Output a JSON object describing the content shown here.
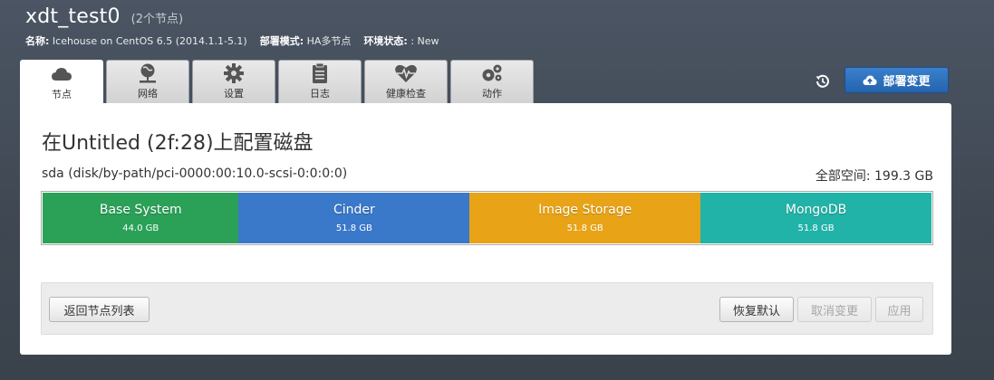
{
  "header": {
    "cluster_name": "xdt_test0",
    "node_count": "(2个节点)",
    "meta_name_label": "名称:",
    "meta_name_value": "Icehouse on CentOS 6.5 (2014.1.1-5.1)",
    "meta_mode_label": "部署模式:",
    "meta_mode_value": "HA多节点",
    "meta_status_label": "环境状态:",
    "meta_status_value": ": New"
  },
  "tabs": [
    {
      "label": "节点",
      "icon": "cloud-icon",
      "active": true
    },
    {
      "label": "网络",
      "icon": "network-icon",
      "active": false
    },
    {
      "label": "设置",
      "icon": "gear-icon",
      "active": false
    },
    {
      "label": "日志",
      "icon": "clipboard-icon",
      "active": false
    },
    {
      "label": "健康检查",
      "icon": "heartbeat-icon",
      "active": false
    },
    {
      "label": "动作",
      "icon": "cogs-icon",
      "active": false
    }
  ],
  "actions": {
    "history_icon": "history-icon",
    "deploy_label": "部署变更"
  },
  "panel": {
    "title": "在Untitled (2f:28)上配置磁盘",
    "disk_name": "sda (disk/by-path/pci-0000:00:10.0-scsi-0:0:0:0)",
    "disk_total": "全部空间: 199.3 GB",
    "volumes": [
      {
        "name": "Base System",
        "size": "44.0 GB",
        "size_gb": 44.0,
        "color": "#2aa157"
      },
      {
        "name": "Cinder",
        "size": "51.8 GB",
        "size_gb": 51.8,
        "color": "#3a78c9"
      },
      {
        "name": "Image Storage",
        "size": "51.8 GB",
        "size_gb": 51.8,
        "color": "#e8a317"
      },
      {
        "name": "MongoDB",
        "size": "51.8 GB",
        "size_gb": 51.8,
        "color": "#21b3a7"
      }
    ]
  },
  "footer": {
    "back_label": "返回节点列表",
    "restore_label": "恢复默认",
    "cancel_label": "取消变更",
    "apply_label": "应用"
  }
}
